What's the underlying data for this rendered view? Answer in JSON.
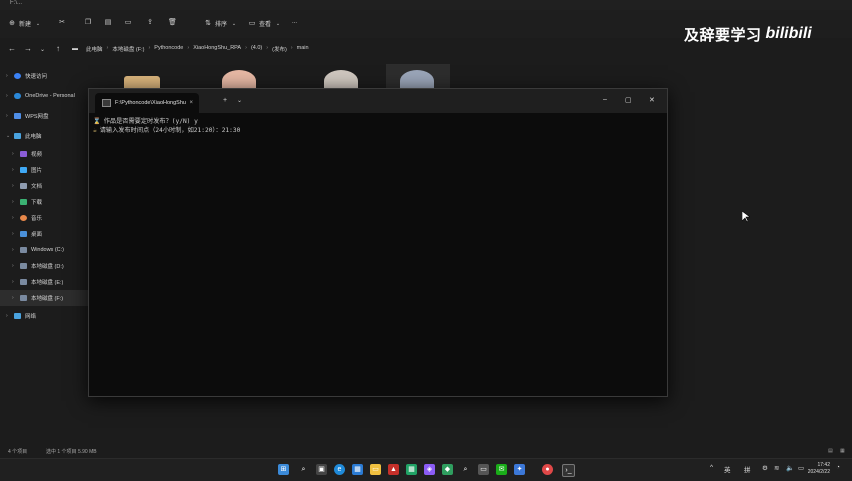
{
  "window": {
    "title": "F:\\..."
  },
  "toolbar": {
    "new_label": "新建",
    "sort_label": "排序",
    "view_label": "查看",
    "more_label": "..."
  },
  "breadcrumb": [
    "此电脑",
    "本地磁盘 (F:)",
    "Pythoncode",
    "XiaoHongShu_RPA",
    "(4.0)",
    "(发布)",
    "main"
  ],
  "sidebar": {
    "items": [
      {
        "label": "快速访问",
        "chev": "›"
      },
      {
        "label": "OneDrive - Personal",
        "chev": "›"
      },
      {
        "label": "WPS网盘",
        "chev": "›"
      },
      {
        "label": "此电脑",
        "chev": "⌄"
      },
      {
        "label": "视频",
        "chev": "›"
      },
      {
        "label": "图片",
        "chev": "›"
      },
      {
        "label": "文档",
        "chev": "›"
      },
      {
        "label": "下载",
        "chev": "›"
      },
      {
        "label": "音乐",
        "chev": "›"
      },
      {
        "label": "桌面",
        "chev": "›"
      },
      {
        "label": "Windows (C:)",
        "chev": "›"
      },
      {
        "label": "本地磁盘 (D:)",
        "chev": "›"
      },
      {
        "label": "本地磁盘 (E:)",
        "chev": "›"
      },
      {
        "label": "本地磁盘 (F:)",
        "chev": "›"
      },
      {
        "label": "网络",
        "chev": "›"
      }
    ]
  },
  "terminal": {
    "tab_title": "F:\\Pythoncode\\XiaoHongShu",
    "close_glyph": "×",
    "new_tab_glyph": "+",
    "dropdown_glyph": "⌄",
    "lines": [
      {
        "symbol": "⌛",
        "text": "作品是否需要定时发布？(y/N) y"
      },
      {
        "symbol": "☕",
        "text": "请输入发布时间点（24小时制，如21:20）：21:30"
      }
    ]
  },
  "statusbar": {
    "items_count": "4 个项目",
    "selected": "选中 1 个项目  5.90 MB"
  },
  "taskbar": {
    "ime_lang": "英",
    "ime_mode": "拼",
    "time": "17:42",
    "date": "2024/2/22"
  },
  "watermark": {
    "chinese": "及辞要学习",
    "brand": "bilibili"
  },
  "colors": {
    "terminal_bg": "#0c0c0c",
    "explorer_bg": "#1c1c1c",
    "taskbar_bg": "#202020"
  }
}
